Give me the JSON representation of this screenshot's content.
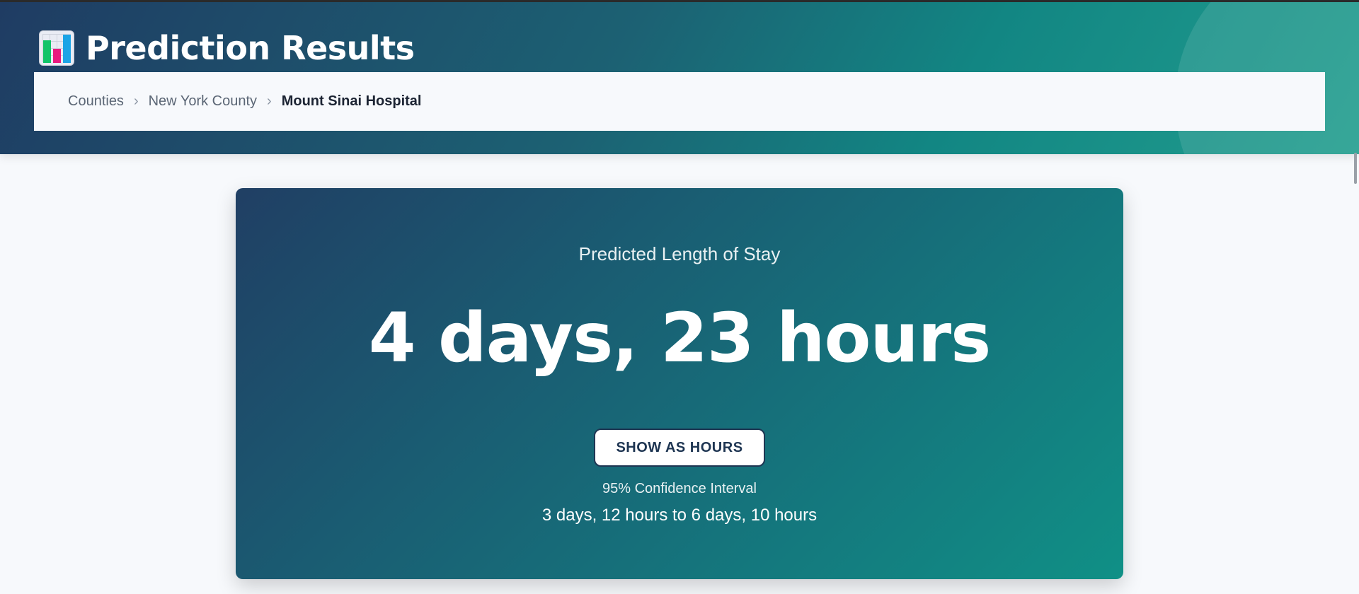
{
  "header": {
    "title": "Prediction Results",
    "icon": "bar-chart-icon",
    "accent_colors": [
      "#1f3c63",
      "#128683",
      "#219d8e"
    ]
  },
  "breadcrumb": {
    "items": [
      "Counties",
      "New York County",
      "Mount Sinai Hospital"
    ],
    "separator": "›"
  },
  "result": {
    "label": "Predicted Length of Stay",
    "value": "4 days, 23 hours",
    "toggle_label": "SHOW AS HOURS",
    "ci_label": "95% Confidence Interval",
    "ci_range": "3 days, 12 hours to 6 days, 10 hours"
  }
}
